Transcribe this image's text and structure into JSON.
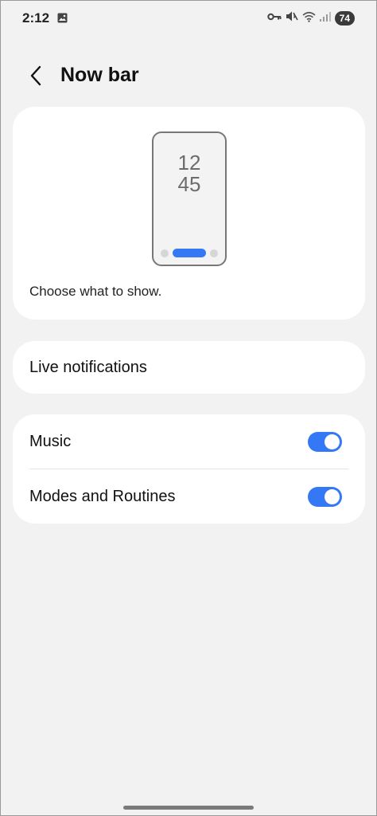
{
  "status_bar": {
    "time": "2:12",
    "battery": "74",
    "icons": [
      "gallery-icon",
      "key-icon",
      "mute-icon",
      "wifi-icon",
      "signal-icon"
    ]
  },
  "header": {
    "back_icon": "chevron-left-icon",
    "title": "Now bar"
  },
  "preview": {
    "clock_hour": "12",
    "clock_minute": "45",
    "caption": "Choose what to show."
  },
  "live_notifications": {
    "label": "Live notifications"
  },
  "toggles": [
    {
      "label": "Music",
      "enabled": true
    },
    {
      "label": "Modes and Routines",
      "enabled": true
    }
  ],
  "colors": {
    "accent": "#3478f6",
    "background": "#f2f2f2",
    "card": "#ffffff"
  }
}
